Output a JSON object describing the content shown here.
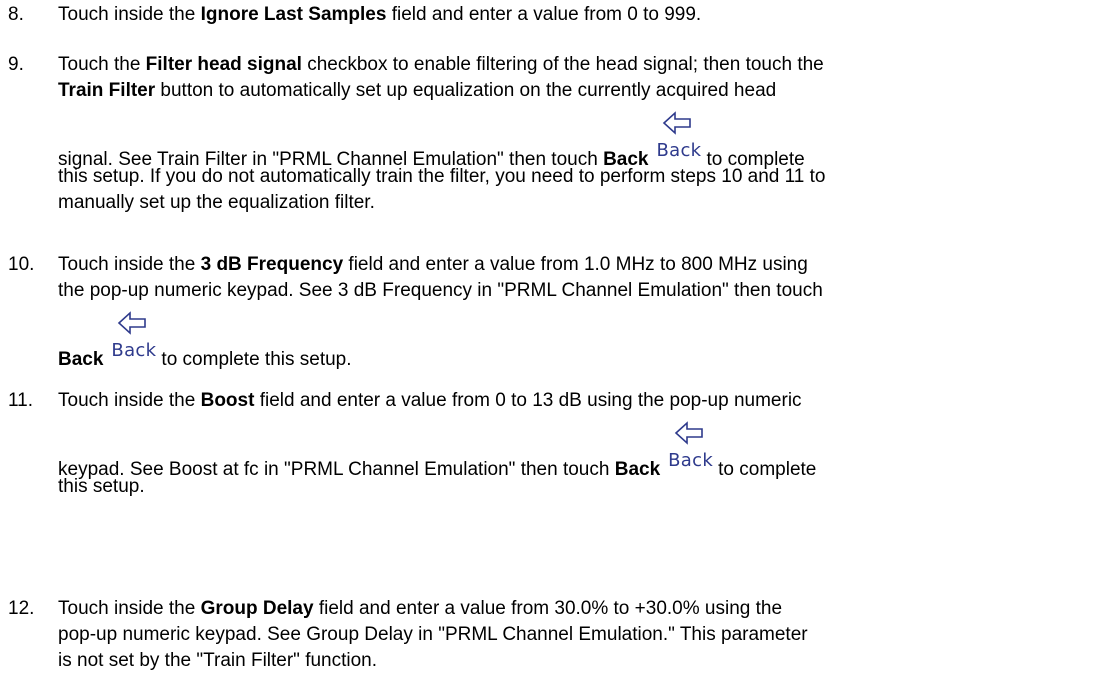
{
  "steps": [
    {
      "number": "8.",
      "line1": {
        "a": "Touch inside the ",
        "b": "Ignore Last Samples",
        "c": " field and enter a value from 0 to 999."
      }
    },
    {
      "number": "9.",
      "line1": {
        "a": "Touch the ",
        "b": "Filter head signal",
        "c": " checkbox to enable filtering of the head signal; then touch the"
      },
      "line2": {
        "b": "Train Filter",
        "c": " button to automatically set up equalization on the currently acquired head"
      },
      "line3": {
        "a": "signal. See Train Filter in \"PRML Channel Emulation\" then touch ",
        "b": "Back",
        "c": "to complete"
      },
      "line4": "this setup. If you do not automatically train the filter, you need to perform steps 10 and 11 to",
      "line5": "manually set up the equalization filter."
    },
    {
      "number": "10.",
      "line1": {
        "a": "Touch inside the ",
        "b": "3 dB Frequency",
        "c": " field and enter a value from 1.0 MHz to 800 MHz using"
      },
      "line2": "the pop-up numeric keypad. See 3 dB Frequency in \"PRML Channel Emulation\" then touch",
      "line3": {
        "b": "Back",
        "c": "to complete this setup."
      }
    },
    {
      "number": "11.",
      "line1": {
        "a": "Touch inside the ",
        "b": "Boost",
        "c": " field and enter a value from 0 to 13 dB using the pop-up numeric"
      },
      "line2": {
        "a": "keypad. See Boost at fc in \"PRML Channel Emulation\" then touch ",
        "b": "Back",
        "c": "to complete"
      },
      "line3": "this setup."
    },
    {
      "number": "12.",
      "line1": {
        "a": "Touch inside the ",
        "b": "Group Delay",
        "c": " field and enter a value from 30.0% to +30.0% using the"
      },
      "line2": "pop-up numeric keypad. See Group Delay in \"PRML Channel Emulation.\" This parameter",
      "line3": "is not set by the \"Train Filter\" function."
    }
  ],
  "back_button": {
    "label": "Back",
    "icon": "left-arrow-icon",
    "label_color": "#2e3a8c"
  }
}
